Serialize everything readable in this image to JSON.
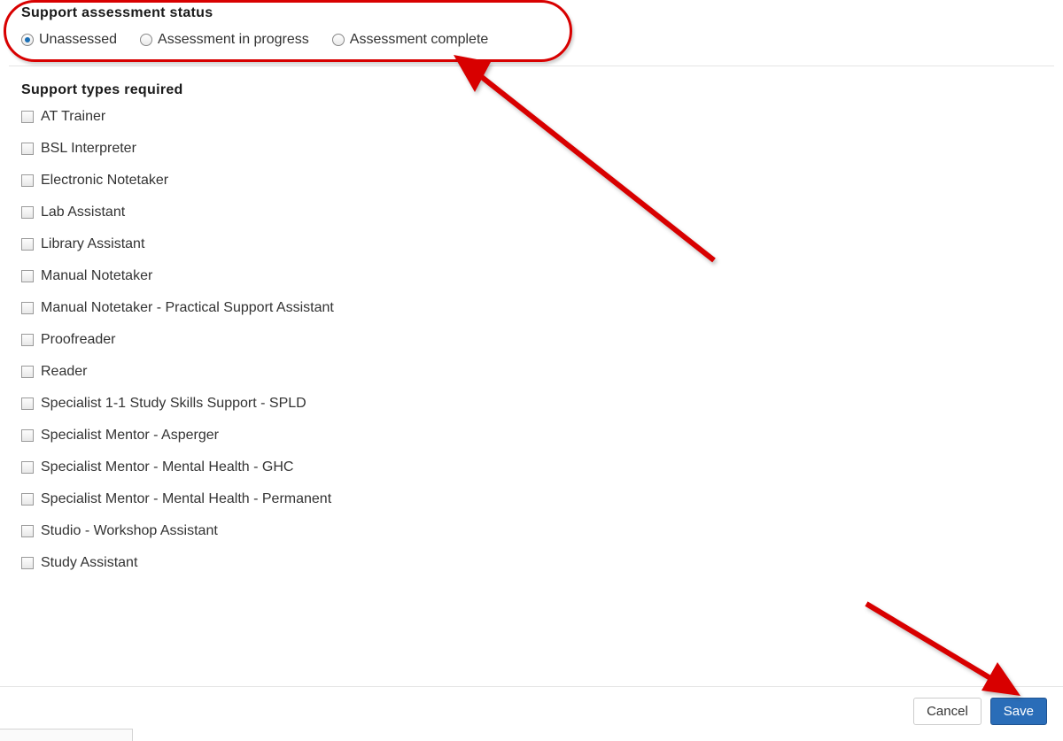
{
  "status": {
    "heading": "Support assessment status",
    "options": [
      {
        "label": "Unassessed",
        "checked": true
      },
      {
        "label": "Assessment in progress",
        "checked": false
      },
      {
        "label": "Assessment complete",
        "checked": false
      }
    ]
  },
  "types": {
    "heading": "Support types required",
    "items": [
      {
        "label": "AT Trainer"
      },
      {
        "label": "BSL Interpreter"
      },
      {
        "label": "Electronic Notetaker"
      },
      {
        "label": "Lab Assistant"
      },
      {
        "label": "Library Assistant"
      },
      {
        "label": "Manual Notetaker"
      },
      {
        "label": "Manual Notetaker - Practical Support Assistant"
      },
      {
        "label": "Proofreader"
      },
      {
        "label": "Reader"
      },
      {
        "label": "Specialist 1-1 Study Skills Support - SPLD"
      },
      {
        "label": "Specialist Mentor - Asperger"
      },
      {
        "label": "Specialist Mentor - Mental Health - GHC"
      },
      {
        "label": "Specialist Mentor - Mental Health - Permanent"
      },
      {
        "label": "Studio - Workshop Assistant"
      },
      {
        "label": "Study Assistant"
      }
    ]
  },
  "footer": {
    "cancel_label": "Cancel",
    "save_label": "Save"
  },
  "annotations": {
    "color": "#d80000"
  }
}
